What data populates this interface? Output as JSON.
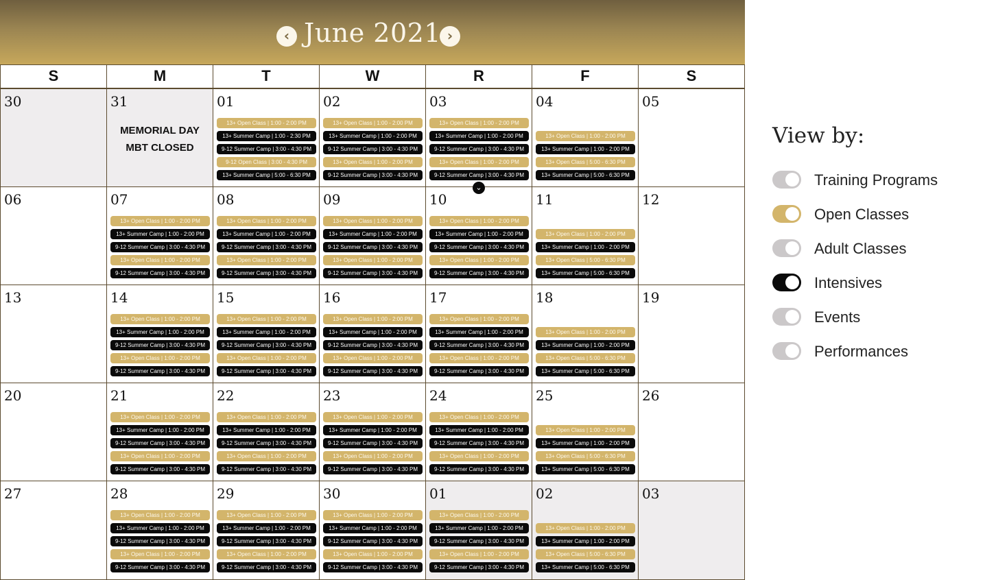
{
  "calendar": {
    "month_title": "June 2021",
    "prev_label": "‹",
    "next_label": "›",
    "weekdays": [
      "S",
      "M",
      "T",
      "W",
      "R",
      "F",
      "S"
    ],
    "expand_label": "⌄",
    "weeks": [
      [
        {
          "day": "30",
          "muted": true,
          "events": []
        },
        {
          "day": "31",
          "muted": true,
          "note_lines": [
            "MEMORIAL DAY",
            "MBT CLOSED"
          ],
          "events": []
        },
        {
          "day": "01",
          "events": [
            {
              "type": "gold",
              "text": "13+ Open Class | 1:00 - 2:00 PM"
            },
            {
              "type": "black",
              "text": "13+ Summer Camp | 1:00 - 2:30 PM"
            },
            {
              "type": "black",
              "text": "9-12 Summer Camp | 3:00 - 4:30 PM"
            },
            {
              "type": "gold",
              "text": "9-12 Open Class | 3:00 - 4:30 PM"
            },
            {
              "type": "black",
              "text": "13+ Summer Camp | 5:00 - 6:30 PM"
            }
          ]
        },
        {
          "day": "02",
          "events": [
            {
              "type": "gold",
              "text": "13+ Open Class | 1:00 - 2:00 PM"
            },
            {
              "type": "black",
              "text": "13+ Summer Camp | 1:00 - 2:00 PM"
            },
            {
              "type": "black",
              "text": "9-12 Summer Camp | 3:00 - 4:30 PM"
            },
            {
              "type": "gold",
              "text": "13+ Open Class | 1:00 - 2:00 PM"
            },
            {
              "type": "black",
              "text": "9-12 Summer Camp | 3:00 - 4:30 PM"
            }
          ]
        },
        {
          "day": "03",
          "events": [
            {
              "type": "gold",
              "text": "13+ Open Class | 1:00 - 2:00 PM"
            },
            {
              "type": "black",
              "text": "13+ Summer Camp | 1:00 - 2:00 PM"
            },
            {
              "type": "black",
              "text": "9-12 Summer Camp | 3:00 - 4:30 PM"
            },
            {
              "type": "gold",
              "text": "13+ Open Class | 1:00 - 2:00 PM"
            },
            {
              "type": "black",
              "text": "9-12 Summer Camp | 3:00 - 4:30 PM"
            }
          ]
        },
        {
          "day": "04",
          "events": [
            {
              "type": "gold",
              "text": "13+ Open Class | 1:00 - 2:00 PM"
            },
            {
              "type": "black",
              "text": "13+ Summer Camp | 1:00 - 2:00 PM"
            },
            {
              "type": "gold",
              "text": "13+ Open Class | 5:00 - 6:30 PM"
            },
            {
              "type": "black",
              "text": "13+ Summer Camp | 5:00 - 6:30 PM"
            }
          ]
        },
        {
          "day": "05",
          "events": []
        }
      ],
      [
        {
          "day": "06",
          "events": []
        },
        {
          "day": "07",
          "events": [
            {
              "type": "gold",
              "text": "13+ Open Class | 1:00 - 2:00 PM"
            },
            {
              "type": "black",
              "text": "13+ Summer Camp | 1:00 - 2:00 PM"
            },
            {
              "type": "black",
              "text": "9-12 Summer Camp | 3:00 - 4:30 PM"
            },
            {
              "type": "gold",
              "text": "13+ Open Class | 1:00 - 2:00 PM"
            },
            {
              "type": "black",
              "text": "9-12 Summer Camp | 3:00 - 4:30 PM"
            }
          ]
        },
        {
          "day": "08",
          "events": [
            {
              "type": "gold",
              "text": "13+ Open Class | 1:00 - 2:00 PM"
            },
            {
              "type": "black",
              "text": "13+ Summer Camp | 1:00 - 2:00 PM"
            },
            {
              "type": "black",
              "text": "9-12 Summer Camp | 3:00 - 4:30 PM"
            },
            {
              "type": "gold",
              "text": "13+ Open Class | 1:00 - 2:00 PM"
            },
            {
              "type": "black",
              "text": "9-12 Summer Camp | 3:00 - 4:30 PM"
            }
          ]
        },
        {
          "day": "09",
          "events": [
            {
              "type": "gold",
              "text": "13+ Open Class | 1:00 - 2:00 PM"
            },
            {
              "type": "black",
              "text": "13+ Summer Camp | 1:00 - 2:00 PM"
            },
            {
              "type": "black",
              "text": "9-12 Summer Camp | 3:00 - 4:30 PM"
            },
            {
              "type": "gold",
              "text": "13+ Open Class | 1:00 - 2:00 PM"
            },
            {
              "type": "black",
              "text": "9-12 Summer Camp | 3:00 - 4:30 PM"
            }
          ]
        },
        {
          "day": "10",
          "events": [
            {
              "type": "gold",
              "text": "13+ Open Class | 1:00 - 2:00 PM"
            },
            {
              "type": "black",
              "text": "13+ Summer Camp | 1:00 - 2:00 PM"
            },
            {
              "type": "black",
              "text": "9-12 Summer Camp | 3:00 - 4:30 PM"
            },
            {
              "type": "gold",
              "text": "13+ Open Class | 1:00 - 2:00 PM"
            },
            {
              "type": "black",
              "text": "9-12 Summer Camp | 3:00 - 4:30 PM"
            }
          ]
        },
        {
          "day": "11",
          "events": [
            {
              "type": "gold",
              "text": "13+ Open Class | 1:00 - 2:00 PM"
            },
            {
              "type": "black",
              "text": "13+ Summer Camp | 1:00 - 2:00 PM"
            },
            {
              "type": "gold",
              "text": "13+ Open Class | 5:00 - 6:30 PM"
            },
            {
              "type": "black",
              "text": "13+ Summer Camp | 5:00 - 6:30 PM"
            }
          ]
        },
        {
          "day": "12",
          "events": []
        }
      ],
      [
        {
          "day": "13",
          "events": []
        },
        {
          "day": "14",
          "events": [
            {
              "type": "gold",
              "text": "13+ Open Class | 1:00 - 2:00 PM"
            },
            {
              "type": "black",
              "text": "13+ Summer Camp | 1:00 - 2:00 PM"
            },
            {
              "type": "black",
              "text": "9-12 Summer Camp | 3:00 - 4:30 PM"
            },
            {
              "type": "gold",
              "text": "13+ Open Class | 1:00 - 2:00 PM"
            },
            {
              "type": "black",
              "text": "9-12 Summer Camp | 3:00 - 4:30 PM"
            }
          ]
        },
        {
          "day": "15",
          "events": [
            {
              "type": "gold",
              "text": "13+ Open Class | 1:00 - 2:00 PM"
            },
            {
              "type": "black",
              "text": "13+ Summer Camp | 1:00 - 2:00 PM"
            },
            {
              "type": "black",
              "text": "9-12 Summer Camp | 3:00 - 4:30 PM"
            },
            {
              "type": "gold",
              "text": "13+ Open Class | 1:00 - 2:00 PM"
            },
            {
              "type": "black",
              "text": "9-12 Summer Camp | 3:00 - 4:30 PM"
            }
          ]
        },
        {
          "day": "16",
          "events": [
            {
              "type": "gold",
              "text": "13+ Open Class | 1:00 - 2:00 PM"
            },
            {
              "type": "black",
              "text": "13+ Summer Camp | 1:00 - 2:00 PM"
            },
            {
              "type": "black",
              "text": "9-12 Summer Camp | 3:00 - 4:30 PM"
            },
            {
              "type": "gold",
              "text": "13+ Open Class | 1:00 - 2:00 PM"
            },
            {
              "type": "black",
              "text": "9-12 Summer Camp | 3:00 - 4:30 PM"
            }
          ]
        },
        {
          "day": "17",
          "events": [
            {
              "type": "gold",
              "text": "13+ Open Class | 1:00 - 2:00 PM"
            },
            {
              "type": "black",
              "text": "13+ Summer Camp | 1:00 - 2:00 PM"
            },
            {
              "type": "black",
              "text": "9-12 Summer Camp | 3:00 - 4:30 PM"
            },
            {
              "type": "gold",
              "text": "13+ Open Class | 1:00 - 2:00 PM"
            },
            {
              "type": "black",
              "text": "9-12 Summer Camp | 3:00 - 4:30 PM"
            }
          ]
        },
        {
          "day": "18",
          "events": [
            {
              "type": "gold",
              "text": "13+ Open Class | 1:00 - 2:00 PM"
            },
            {
              "type": "black",
              "text": "13+ Summer Camp | 1:00 - 2:00 PM"
            },
            {
              "type": "gold",
              "text": "13+ Open Class | 5:00 - 6:30 PM"
            },
            {
              "type": "black",
              "text": "13+ Summer Camp | 5:00 - 6:30 PM"
            }
          ]
        },
        {
          "day": "19",
          "events": []
        }
      ],
      [
        {
          "day": "20",
          "events": []
        },
        {
          "day": "21",
          "events": [
            {
              "type": "gold",
              "text": "13+ Open Class | 1:00 - 2:00 PM"
            },
            {
              "type": "black",
              "text": "13+ Summer Camp | 1:00 - 2:00 PM"
            },
            {
              "type": "black",
              "text": "9-12 Summer Camp | 3:00 - 4:30 PM"
            },
            {
              "type": "gold",
              "text": "13+ Open Class | 1:00 - 2:00 PM"
            },
            {
              "type": "black",
              "text": "9-12 Summer Camp | 3:00 - 4:30 PM"
            }
          ]
        },
        {
          "day": "22",
          "events": [
            {
              "type": "gold",
              "text": "13+ Open Class | 1:00 - 2:00 PM"
            },
            {
              "type": "black",
              "text": "13+ Summer Camp | 1:00 - 2:00 PM"
            },
            {
              "type": "black",
              "text": "9-12 Summer Camp | 3:00 - 4:30 PM"
            },
            {
              "type": "gold",
              "text": "13+ Open Class | 1:00 - 2:00 PM"
            },
            {
              "type": "black",
              "text": "9-12 Summer Camp | 3:00 - 4:30 PM"
            }
          ]
        },
        {
          "day": "23",
          "events": [
            {
              "type": "gold",
              "text": "13+ Open Class | 1:00 - 2:00 PM"
            },
            {
              "type": "black",
              "text": "13+ Summer Camp | 1:00 - 2:00 PM"
            },
            {
              "type": "black",
              "text": "9-12 Summer Camp | 3:00 - 4:30 PM"
            },
            {
              "type": "gold",
              "text": "13+ Open Class | 1:00 - 2:00 PM"
            },
            {
              "type": "black",
              "text": "9-12 Summer Camp | 3:00 - 4:30 PM"
            }
          ]
        },
        {
          "day": "24",
          "events": [
            {
              "type": "gold",
              "text": "13+ Open Class | 1:00 - 2:00 PM"
            },
            {
              "type": "black",
              "text": "13+ Summer Camp | 1:00 - 2:00 PM"
            },
            {
              "type": "black",
              "text": "9-12 Summer Camp | 3:00 - 4:30 PM"
            },
            {
              "type": "gold",
              "text": "13+ Open Class | 1:00 - 2:00 PM"
            },
            {
              "type": "black",
              "text": "9-12 Summer Camp | 3:00 - 4:30 PM"
            }
          ]
        },
        {
          "day": "25",
          "events": [
            {
              "type": "gold",
              "text": "13+ Open Class | 1:00 - 2:00 PM"
            },
            {
              "type": "black",
              "text": "13+ Summer Camp | 1:00 - 2:00 PM"
            },
            {
              "type": "gold",
              "text": "13+ Open Class | 5:00 - 6:30 PM"
            },
            {
              "type": "black",
              "text": "13+ Summer Camp | 5:00 - 6:30 PM"
            }
          ]
        },
        {
          "day": "26",
          "events": []
        }
      ],
      [
        {
          "day": "27",
          "events": []
        },
        {
          "day": "28",
          "events": [
            {
              "type": "gold",
              "text": "13+ Open Class | 1:00 - 2:00 PM"
            },
            {
              "type": "black",
              "text": "13+ Summer Camp | 1:00 - 2:00 PM"
            },
            {
              "type": "black",
              "text": "9-12 Summer Camp | 3:00 - 4:30 PM"
            },
            {
              "type": "gold",
              "text": "13+ Open Class | 1:00 - 2:00 PM"
            },
            {
              "type": "black",
              "text": "9-12 Summer Camp | 3:00 - 4:30 PM"
            }
          ]
        },
        {
          "day": "29",
          "events": [
            {
              "type": "gold",
              "text": "13+ Open Class | 1:00 - 2:00 PM"
            },
            {
              "type": "black",
              "text": "13+ Summer Camp | 1:00 - 2:00 PM"
            },
            {
              "type": "black",
              "text": "9-12 Summer Camp | 3:00 - 4:30 PM"
            },
            {
              "type": "gold",
              "text": "13+ Open Class | 1:00 - 2:00 PM"
            },
            {
              "type": "black",
              "text": "9-12 Summer Camp | 3:00 - 4:30 PM"
            }
          ]
        },
        {
          "day": "30",
          "events": [
            {
              "type": "gold",
              "text": "13+ Open Class | 1:00 - 2:00 PM"
            },
            {
              "type": "black",
              "text": "13+ Summer Camp | 1:00 - 2:00 PM"
            },
            {
              "type": "black",
              "text": "9-12 Summer Camp | 3:00 - 4:30 PM"
            },
            {
              "type": "gold",
              "text": "13+ Open Class | 1:00 - 2:00 PM"
            },
            {
              "type": "black",
              "text": "9-12 Summer Camp | 3:00 - 4:30 PM"
            }
          ]
        },
        {
          "day": "01",
          "muted": true,
          "events": [
            {
              "type": "gold",
              "text": "13+ Open Class | 1:00 - 2:00 PM"
            },
            {
              "type": "black",
              "text": "13+ Summer Camp | 1:00 - 2:00 PM"
            },
            {
              "type": "black",
              "text": "9-12 Summer Camp | 3:00 - 4:30 PM"
            },
            {
              "type": "gold",
              "text": "13+ Open Class | 1:00 - 2:00 PM"
            },
            {
              "type": "black",
              "text": "9-12 Summer Camp | 3:00 - 4:30 PM"
            }
          ]
        },
        {
          "day": "02",
          "muted": true,
          "events": [
            {
              "type": "gold",
              "text": "13+ Open Class | 1:00 - 2:00 PM"
            },
            {
              "type": "black",
              "text": "13+ Summer Camp | 1:00 - 2:00 PM"
            },
            {
              "type": "gold",
              "text": "13+ Open Class | 5:00 - 6:30 PM"
            },
            {
              "type": "black",
              "text": "13+ Summer Camp | 5:00 - 6:30 PM"
            }
          ]
        },
        {
          "day": "03",
          "muted": true,
          "events": []
        }
      ]
    ]
  },
  "legend": {
    "title": "View by:",
    "items": [
      {
        "label": "Training Programs",
        "on": false,
        "color": "#cbc8c9"
      },
      {
        "label": "Open Classes",
        "on": true,
        "color": "#d3b56b"
      },
      {
        "label": "Adult Classes",
        "on": false,
        "color": "#cbc8c9"
      },
      {
        "label": "Intensives",
        "on": true,
        "color": "#0a0a0a"
      },
      {
        "label": "Events",
        "on": false,
        "color": "#cbc8c9"
      },
      {
        "label": "Performances",
        "on": false,
        "color": "#cbc8c9"
      }
    ]
  }
}
